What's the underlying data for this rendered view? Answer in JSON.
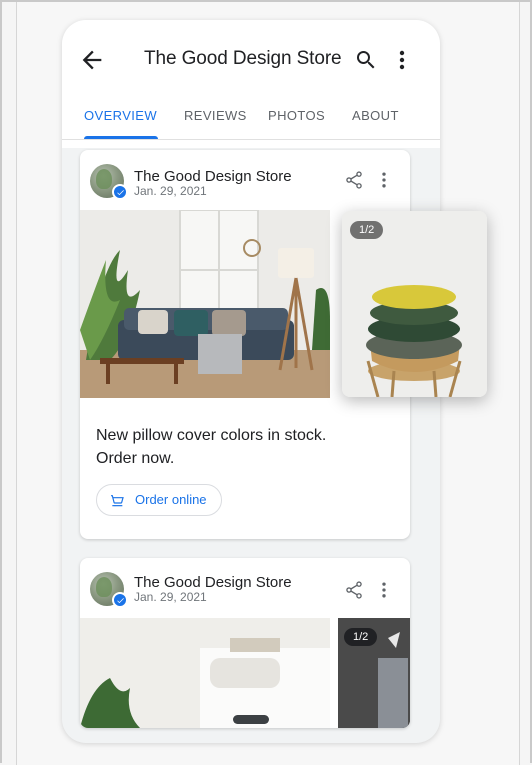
{
  "app": {
    "title": "The Good Design Store"
  },
  "tabs": [
    {
      "label": "OVERVIEW",
      "active": true
    },
    {
      "label": "REVIEWS",
      "active": false
    },
    {
      "label": "PHOTOS",
      "active": false
    },
    {
      "label": "ABOUT",
      "active": false
    }
  ],
  "posts": [
    {
      "author": "The Good Design Store",
      "date": "Jan. 29, 2021",
      "pager": "1/2",
      "caption_line1": "New pillow cover colors in stock.",
      "caption_line2": "Order now.",
      "action_label": "Order online"
    },
    {
      "author": "The Good Design Store",
      "date": "Jan. 29, 2021",
      "pager": "1/2"
    }
  ],
  "icons": {
    "back": "arrow-back-icon",
    "search": "search-icon",
    "more": "more-vert-icon",
    "share": "share-icon",
    "cart": "cart-icon",
    "verified": "verified-check-icon"
  },
  "colors": {
    "accent": "#1a73e8",
    "text": "#202124",
    "muted": "#70757a"
  }
}
